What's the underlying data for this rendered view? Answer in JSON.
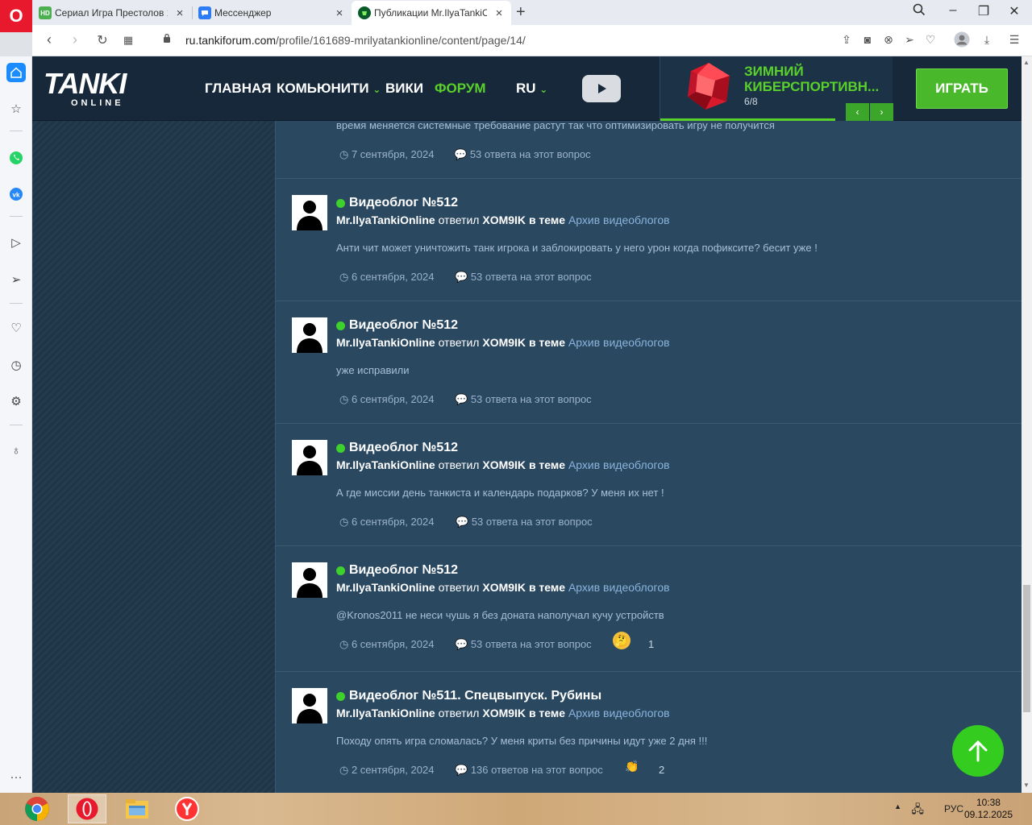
{
  "browser": {
    "tabs": [
      {
        "favicon": "HD",
        "label": "Сериал Игра Престолов 1",
        "active": false
      },
      {
        "favicon": "chat",
        "label": "Мессенджер",
        "active": false
      },
      {
        "favicon": "tanki",
        "label": "Публикации Mr.IlyaTankiO",
        "active": true
      }
    ],
    "url_host": "ru.tankiforum.com",
    "url_path": "/profile/161689-mrilyatankionline/content/page/14/"
  },
  "site": {
    "logo_main": "TANKI",
    "logo_sub": "ONLINE",
    "nav": {
      "home": "ГЛАВНАЯ",
      "community": "КОМЬЮНИТИ",
      "wiki": "ВИКИ",
      "forum": "ФОРУМ",
      "lang": "RU"
    },
    "promo": {
      "title": "ЗИМНИЙ КИБЕРСПОРТИВН...",
      "counter": "6/8",
      "progress": 0.75,
      "prev": "‹",
      "next": "›"
    },
    "play_button": "ИГРАТЬ"
  },
  "partial_post": {
    "body": "время меняется системные требование растут так что оптимизировать игру не получится",
    "date": "7 сентября, 2024",
    "replies": "53 ответа на этот вопрос"
  },
  "posts": [
    {
      "title": "Видеоблог №512",
      "author": "Mr.IlyaTankiOnline",
      "verb": "ответил",
      "who": "XOM9IK",
      "in_topic": "в теме",
      "forum": "Архив видеоблогов",
      "body": "Анти чит может уничтожить танк игрока и заблокировать у него урон когда пофиксите? бесит уже !",
      "date": "6 сентября, 2024",
      "replies": "53 ответа на этот вопрос"
    },
    {
      "title": "Видеоблог №512",
      "author": "Mr.IlyaTankiOnline",
      "verb": "ответил",
      "who": "XOM9IK",
      "in_topic": "в теме",
      "forum": "Архив видеоблогов",
      "body": "уже исправили",
      "date": "6 сентября, 2024",
      "replies": "53 ответа на этот вопрос"
    },
    {
      "title": "Видеоблог №512",
      "author": "Mr.IlyaTankiOnline",
      "verb": "ответил",
      "who": "XOM9IK",
      "in_topic": "в теме",
      "forum": "Архив видеоблогов",
      "body": "А где миссии день танкиста и календарь подарков? У меня их нет !",
      "date": "6 сентября, 2024",
      "replies": "53 ответа на этот вопрос"
    },
    {
      "title": "Видеоблог №512",
      "author": "Mr.IlyaTankiOnline",
      "verb": "ответил",
      "who": "XOM9IK",
      "in_topic": "в теме",
      "forum": "Архив видеоблогов",
      "body": "@Kronos2011 не неси чушь я без доната наполучал кучу устройств",
      "date": "6 сентября, 2024",
      "replies": "53 ответа на этот вопрос",
      "reaction_icon": "thinking-face-icon",
      "reaction_count": "1"
    },
    {
      "title": "Видеоблог №511. Спецвыпуск. Рубины",
      "author": "Mr.IlyaTankiOnline",
      "verb": "ответил",
      "who": "XOM9IK",
      "in_topic": "в теме",
      "forum": "Архив видеоблогов",
      "body": "Походу опять игра сломалась? У меня криты без причины идут уже 2 дня !!!",
      "date": "2 сентября, 2024",
      "replies": "136 ответов на этот вопрос",
      "reaction_icon": "clapping-hands-icon",
      "reaction_count": "2"
    }
  ],
  "taskbar": {
    "apps": [
      "chrome-icon",
      "opera-icon",
      "file-explorer-icon",
      "yandex-browser-icon"
    ],
    "lang": "РУС",
    "time": "10:38",
    "date": "09.12.2025"
  },
  "colors": {
    "accent_green": "#5ad12b",
    "online_dot": "#3fd12b",
    "link_blue": "#8ab4dd",
    "page_bg": "#2b4861"
  }
}
